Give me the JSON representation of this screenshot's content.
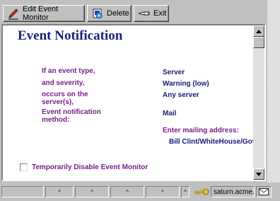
{
  "toolbar": {
    "edit_label": "Edit Event Monitor",
    "delete_label": "Delete",
    "exit_label": "Exit"
  },
  "page": {
    "title": "Event Notification"
  },
  "form": {
    "event_type_label": "If an event type,",
    "severity_label": "and severity,",
    "server_label_line1": "occurs on the",
    "server_label_line2": "server(s),",
    "method_label_line1": "Event notification",
    "method_label_line2": "method:",
    "event_type_value": "Server",
    "severity_value": "Warning (low)",
    "server_value": "Any server",
    "method_value": "Mail",
    "mail_address_label": "Enter mailing address:",
    "mail_address_value": "Bill Clint/WhiteHouse/Gov"
  },
  "disable_checkbox": {
    "label": "Temporarily Disable Event Monitor",
    "checked": false
  },
  "statusbar": {
    "caret": "^",
    "server_name": "saturn.acme.cc"
  },
  "colors": {
    "title": "#1e1e7a",
    "label": "#7a1f8a",
    "value": "#1a1a7a",
    "chrome": "#c0c0c0"
  },
  "icons": [
    "pen-icon",
    "delete-icon",
    "exit-icon",
    "key-icon",
    "mail-icon",
    "scroll-up-icon",
    "scroll-down-icon"
  ]
}
